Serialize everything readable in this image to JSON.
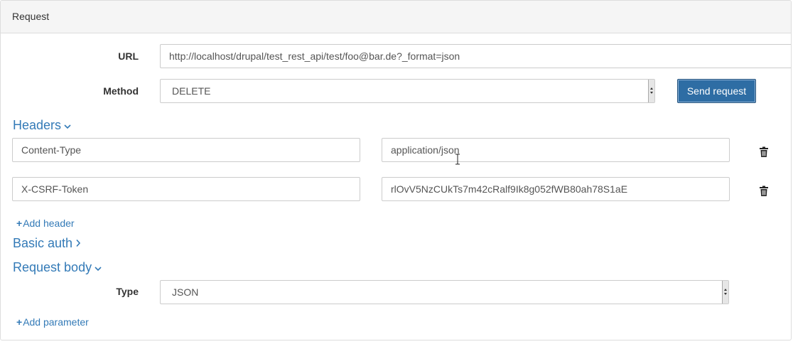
{
  "panel": {
    "title": "Request"
  },
  "url": {
    "label": "URL",
    "value": "http://localhost/drupal/test_rest_api/test/foo@bar.de?_format=json"
  },
  "method": {
    "label": "Method",
    "value": "DELETE"
  },
  "send_label": "Send request",
  "headers": {
    "title": "Headers",
    "rows": [
      {
        "key": "Content-Type",
        "value": "application/json"
      },
      {
        "key": "X-CSRF-Token",
        "value": "rlOvV5NzCUkTs7m42cRalf9Ik8g052fWB80ah78S1aE"
      }
    ],
    "add_label": "Add header"
  },
  "basic_auth": {
    "title": "Basic auth"
  },
  "body": {
    "title": "Request body",
    "type_label": "Type",
    "type_value": "JSON",
    "add_label": "Add parameter"
  },
  "icons": {
    "chevron_down": "chevron-down-icon",
    "chevron_right": "chevron-right-icon",
    "trash": "trash-icon",
    "plus": "plus-icon"
  },
  "colors": {
    "link": "#337ab7",
    "primary": "#2e6da4",
    "heading_bg": "#f5f5f5"
  }
}
